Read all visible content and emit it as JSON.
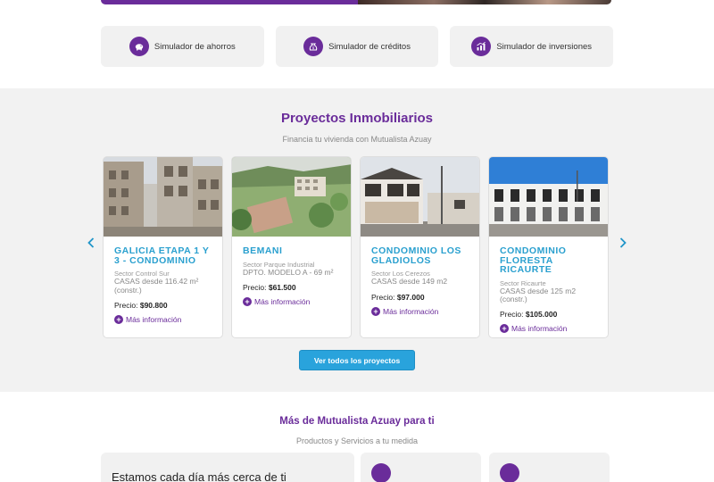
{
  "colors": {
    "brand_purple": "#6a2c9a",
    "accent_blue": "#2aa0cf",
    "button_blue": "#29a3dc",
    "section_bg": "#f2f2f2"
  },
  "simulators": [
    {
      "label": "Simulador de ahorros",
      "icon": "piggy-bank-icon"
    },
    {
      "label": "Simulador de créditos",
      "icon": "money-bag-icon"
    },
    {
      "label": "Simulador de inversiones",
      "icon": "growth-chart-icon"
    }
  ],
  "projects": {
    "title": "Proyectos Inmobiliarios",
    "subtitle": "Financia tu vivienda con Mutualista Azuay",
    "cards": [
      {
        "title": "GALICIA ETAPA 1 Y 3 - Condominio",
        "sector": "Sector Control Sur",
        "description": "CASAS desde 116.42 m² (constr.)",
        "price_label": "Precio:",
        "price": "$90.800",
        "more": "Más información"
      },
      {
        "title": "BEMANI",
        "sector": "Sector Parque Industrial",
        "description": "DPTO. MODELO A - 69 m²",
        "price_label": "Precio:",
        "price": "$61.500",
        "more": "Más información"
      },
      {
        "title": "CONDOMINIO LOS GLADIOLOS",
        "sector": "Sector Los Cerezos",
        "description": "CASAS desde 149 m2",
        "price_label": "Precio:",
        "price": "$97.000",
        "more": "Más información"
      },
      {
        "title": "CONDOMINIO FLORESTA RICAURTE",
        "sector": "Sector Ricaurte",
        "description": "CASAS desde 125 m2 (constr.)",
        "price_label": "Precio:",
        "price": "$105.000",
        "more": "Más información"
      }
    ],
    "view_all": "Ver todos los proyectos"
  },
  "more_section": {
    "title": "Más de Mutualista Azuay para ti",
    "subtitle": "Productos y Servicios a tu medida",
    "main_box_text": "Estamos cada día más cerca de ti"
  }
}
